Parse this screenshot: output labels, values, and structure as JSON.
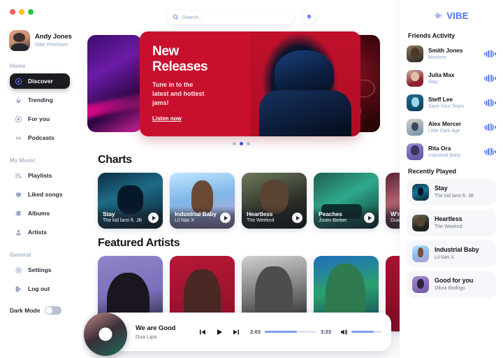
{
  "window": {
    "traffic_lights": [
      "close",
      "minimize",
      "maximize"
    ]
  },
  "sidebar": {
    "profile": {
      "name": "Andy Jones",
      "plan": "Vibe Premium",
      "avatar_icon": "user-avatar"
    },
    "sections": [
      {
        "label": "Home",
        "items": [
          {
            "label": "Discover",
            "icon": "compass-icon",
            "active": true
          },
          {
            "label": "Trending",
            "icon": "flame-icon",
            "active": false
          },
          {
            "label": "For you",
            "icon": "target-icon",
            "active": false
          },
          {
            "label": "Podcasts",
            "icon": "broadcast-icon",
            "active": false
          }
        ]
      },
      {
        "label": "My Music",
        "items": [
          {
            "label": "Playlists",
            "icon": "playlist-icon",
            "active": false
          },
          {
            "label": "Liked songs",
            "icon": "heart-icon",
            "active": false
          },
          {
            "label": "Albums",
            "icon": "albums-icon",
            "active": false
          },
          {
            "label": "Artists",
            "icon": "person-icon",
            "active": false
          }
        ]
      },
      {
        "label": "General",
        "items": [
          {
            "label": "Settings",
            "icon": "gear-icon",
            "active": false
          },
          {
            "label": "Log out",
            "icon": "logout-icon",
            "active": false
          }
        ]
      }
    ],
    "dark_mode": {
      "label": "Dark Mode",
      "enabled": false
    }
  },
  "topbar": {
    "search_placeholder": "Search...",
    "search_value": "",
    "search_icon": "search-icon",
    "notification_icon": "bell-icon"
  },
  "hero": {
    "title_line1": "New",
    "title_line2": "Releases",
    "subtitle": "Tune in to the latest and hottest jams!",
    "link": "Listen now",
    "carousel_dots": 3,
    "active_dot": 2
  },
  "charts": {
    "title": "Charts",
    "cards": [
      {
        "title": "Stay",
        "artist": "The kid laroi ft. JB",
        "art": "a-stay"
      },
      {
        "title": "Industrial Baby",
        "artist": "Lil Nas X",
        "art": "a-indb"
      },
      {
        "title": "Heartless",
        "artist": "The Weeknd",
        "art": "a-hrt"
      },
      {
        "title": "Peaches",
        "artist": "Justin Bieber",
        "art": "a-pch"
      },
      {
        "title": "W're G",
        "artist": "Dua Lipa",
        "art": "a-wrg"
      }
    ]
  },
  "featured": {
    "title": "Featured Artists",
    "cards": [
      "f1",
      "f2",
      "f3",
      "f4",
      "f5"
    ]
  },
  "player": {
    "track_title": "We are Good",
    "artist": "Dua Lipa",
    "elapsed": "2:03",
    "duration": "3:23",
    "progress_percent": 62,
    "volume_percent": 72,
    "prev_icon": "skip-back-icon",
    "play_icon": "play-icon",
    "next_icon": "skip-forward-icon",
    "volume_icon": "volume-icon"
  },
  "right_panel": {
    "brand": {
      "name": "VIBE",
      "icon": "waveform-icon",
      "color": "#4f6ef7"
    },
    "friends_activity": {
      "title": "Friends Activity",
      "items": [
        {
          "name": "Smith Jones",
          "song": "Montero",
          "av": "fv1"
        },
        {
          "name": "Julia Max",
          "song": "Stay",
          "av": "fv2"
        },
        {
          "name": "Steff Lee",
          "song": "Save Your Tears",
          "av": "fv3"
        },
        {
          "name": "Alex Mercer",
          "song": "Little Dark Age",
          "av": "fv4"
        },
        {
          "name": "Rita Ora",
          "song": "Industrial Baby",
          "av": "fv5"
        }
      ]
    },
    "recently_played": {
      "title": "Recently Played",
      "items": [
        {
          "title": "Stay",
          "artist": "The kid laroi ft. JB",
          "av": "rp1"
        },
        {
          "title": "Heartless",
          "artist": "The Weeknd",
          "av": "rp2"
        },
        {
          "title": "Industrial Baby",
          "artist": "Lil Nas X",
          "av": "rp3"
        },
        {
          "title": "Good for you",
          "artist": "Olivia Rodrigo",
          "av": "rp4"
        }
      ]
    }
  }
}
